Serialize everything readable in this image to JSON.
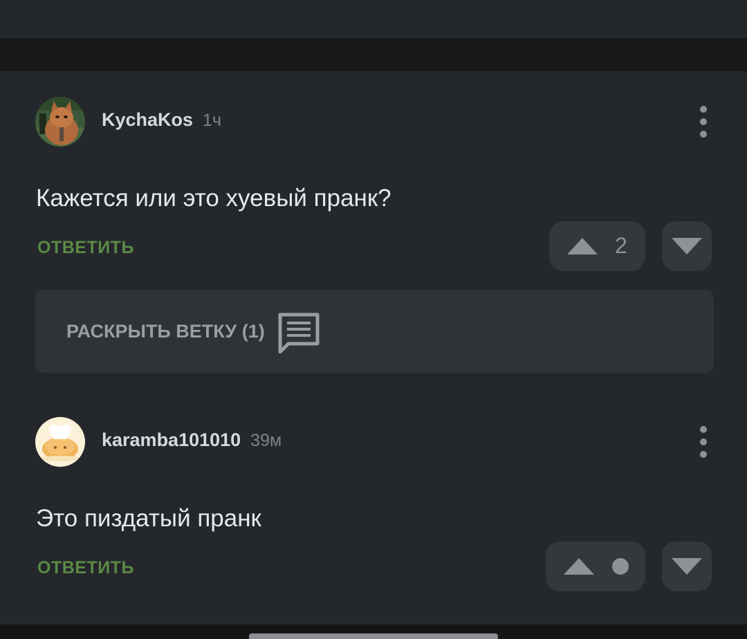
{
  "comments": [
    {
      "username": "KychaKos",
      "time": "1ч",
      "text": "Кажется или это хуевый пранк?",
      "reply_label": "ОТВЕТИТЬ",
      "votes": "2",
      "avatar_icon": "cat-avatar-icon",
      "expand_thread_label": "РАСКРЫТЬ ВЕТКУ (1)"
    },
    {
      "username": "karamba101010",
      "time": "39м",
      "text": "Это пиздатый пранк",
      "reply_label": "ОТВЕТИТЬ",
      "votes_state": "dot",
      "avatar_icon": "bread-chef-avatar-icon"
    }
  ],
  "colors": {
    "background": "#24272b",
    "separator": "#17181a",
    "reply_accent": "#5c8a45",
    "vote_button": "#34373c",
    "icon": "#8e9195"
  }
}
